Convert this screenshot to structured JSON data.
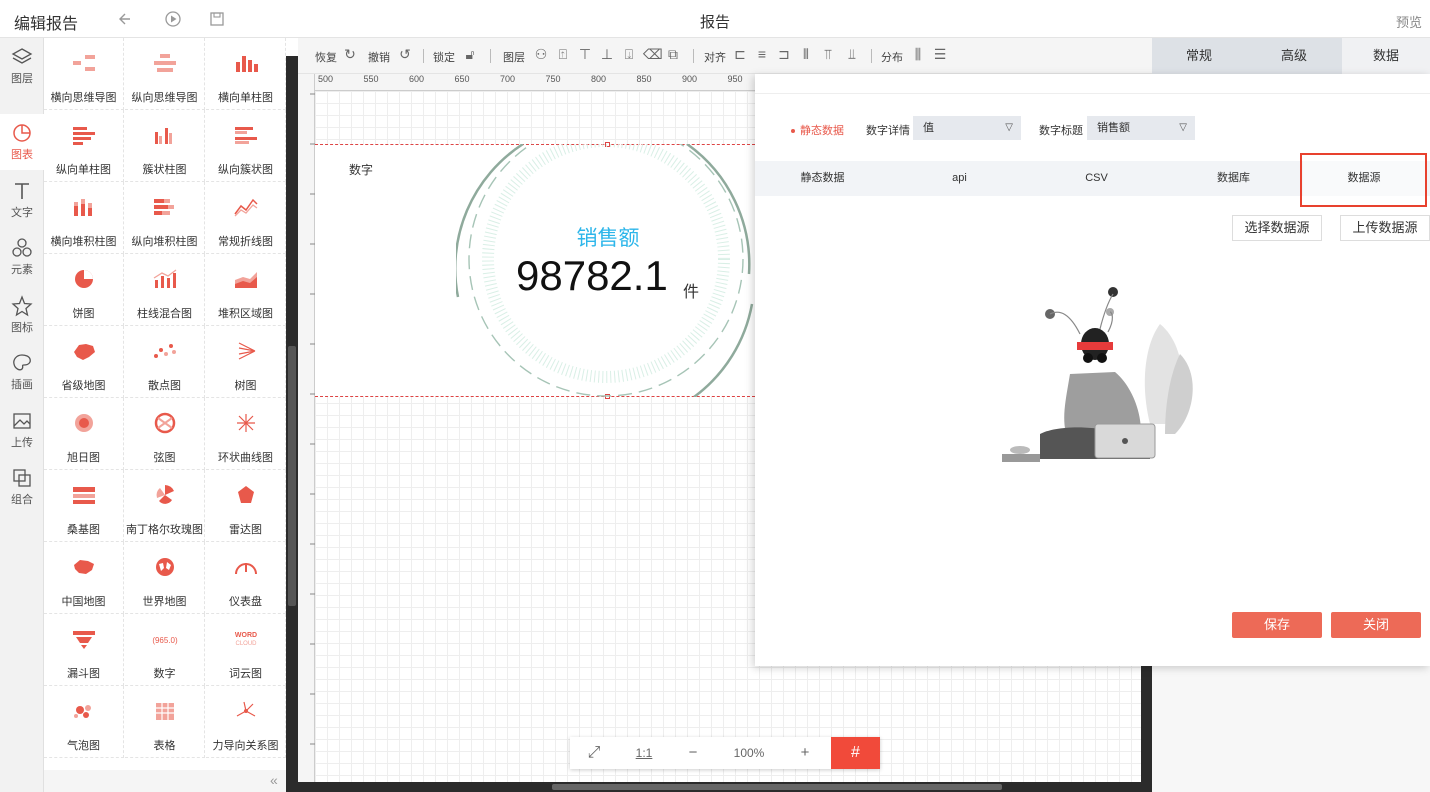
{
  "topbar": {
    "title": "编辑报告",
    "center_title": "报告",
    "preview": "预览"
  },
  "rail": [
    {
      "label": "图层",
      "icon": "layers-icon"
    },
    {
      "label": "图表",
      "icon": "pie-chart-icon",
      "active": true
    },
    {
      "label": "文字",
      "icon": "text-icon"
    },
    {
      "label": "元素",
      "icon": "shapes-icon"
    },
    {
      "label": "图标",
      "icon": "star-icon"
    },
    {
      "label": "插画",
      "icon": "palette-icon"
    },
    {
      "label": "上传",
      "icon": "image-upload-icon"
    },
    {
      "label": "组合",
      "icon": "group-icon"
    }
  ],
  "library": {
    "items": [
      {
        "label": "横向思维导图",
        "icon": "mindmap-h-icon"
      },
      {
        "label": "纵向思维导图",
        "icon": "mindmap-v-icon"
      },
      {
        "label": "横向单柱图",
        "icon": "bar-single-icon"
      },
      {
        "label": "纵向单柱图",
        "icon": "bar-h-icon"
      },
      {
        "label": "簇状柱图",
        "icon": "bar-cluster-icon"
      },
      {
        "label": "纵向簇状图",
        "icon": "bar-h-cluster-icon"
      },
      {
        "label": "横向堆积柱图",
        "icon": "bar-stack-icon"
      },
      {
        "label": "纵向堆积柱图",
        "icon": "bar-h-stack-icon"
      },
      {
        "label": "常规折线图",
        "icon": "line-chart-icon"
      },
      {
        "label": "饼图",
        "icon": "pie-icon"
      },
      {
        "label": "柱线混合图",
        "icon": "bar-line-icon"
      },
      {
        "label": "堆积区域图",
        "icon": "area-icon"
      },
      {
        "label": "省级地图",
        "icon": "province-map-icon"
      },
      {
        "label": "散点图",
        "icon": "scatter-icon"
      },
      {
        "label": "树图",
        "icon": "tree-icon"
      },
      {
        "label": "旭日图",
        "icon": "sunburst-icon"
      },
      {
        "label": "弦图",
        "icon": "chord-icon"
      },
      {
        "label": "环状曲线图",
        "icon": "ring-curve-icon"
      },
      {
        "label": "桑基图",
        "icon": "sankey-icon"
      },
      {
        "label": "南丁格尔玫瑰图",
        "icon": "rose-icon"
      },
      {
        "label": "雷达图",
        "icon": "radar-icon"
      },
      {
        "label": "中国地图",
        "icon": "china-map-icon"
      },
      {
        "label": "世界地图",
        "icon": "world-map-icon"
      },
      {
        "label": "仪表盘",
        "icon": "gauge-icon"
      },
      {
        "label": "漏斗图",
        "icon": "funnel-icon"
      },
      {
        "label": "数字",
        "icon": "number-icon"
      },
      {
        "label": "词云图",
        "icon": "wordcloud-icon"
      },
      {
        "label": "气泡图",
        "icon": "bubble-icon"
      },
      {
        "label": "表格",
        "icon": "table-icon"
      },
      {
        "label": "力导向关系图",
        "icon": "force-graph-icon"
      }
    ],
    "number_icon_text": "965.0",
    "wordcloud_icon_text": "WORD CLOUD",
    "collapse": "«"
  },
  "toolbar": {
    "redo": "恢复",
    "undo": "撤销",
    "lock": "锁定",
    "layer": "图层",
    "align": "对齐",
    "distribute": "分布"
  },
  "ruler": {
    "ticks": [
      "500",
      "550",
      "600",
      "650",
      "700",
      "750",
      "800",
      "850",
      "900",
      "950"
    ]
  },
  "widget": {
    "label": "数字",
    "title": "销售额",
    "value": "98782.1",
    "unit": "件"
  },
  "zoom": {
    "fit": "⤢",
    "one_to_one": "1:1",
    "minus": "−",
    "level": "100%",
    "plus": "+",
    "grid": "#"
  },
  "ptabs": [
    {
      "label": "常规"
    },
    {
      "label": "高级"
    },
    {
      "label": "数据",
      "active": true
    }
  ],
  "dialog": {
    "static_radio": "静态数据",
    "detail_label": "数字详情",
    "detail_value": "值",
    "title_label": "数字标题",
    "title_value": "销售额",
    "source_tabs": [
      "静态数据",
      "api",
      "CSV",
      "数据库",
      "数据源"
    ],
    "active_source": "数据源",
    "select_button": "选择数据源",
    "upload_button": "上传数据源",
    "save": "保存",
    "close": "关闭"
  },
  "colors": {
    "accent": "#e8594b",
    "metric_title": "#2db6ea",
    "highlight_box": "#e8412e",
    "button": "#ed6a57"
  }
}
